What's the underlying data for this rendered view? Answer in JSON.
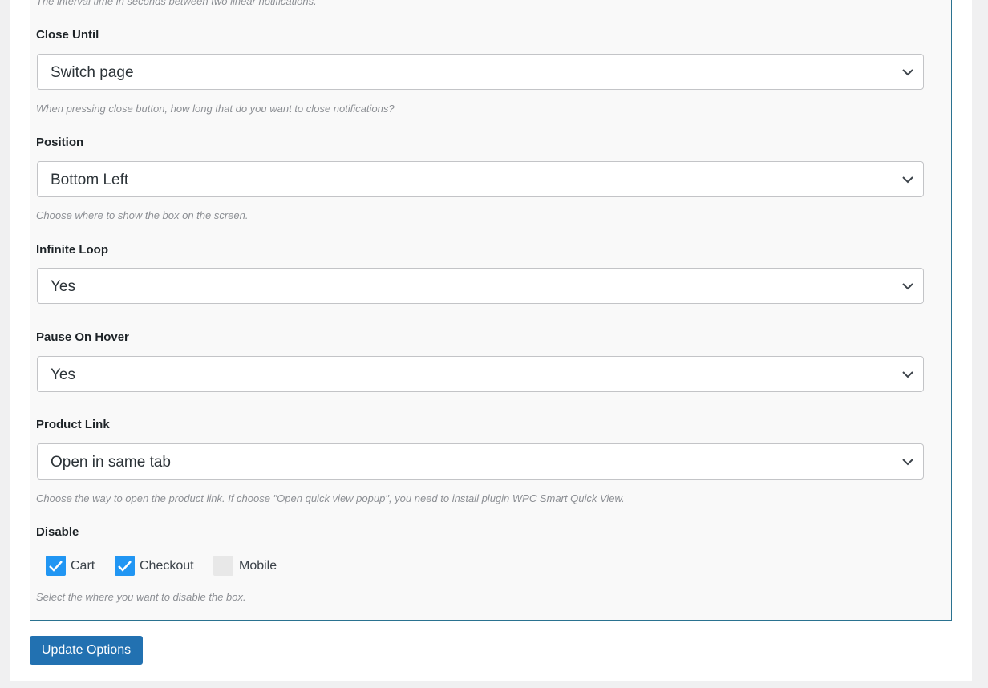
{
  "top_description": "The interval time in seconds between two linear notifications.",
  "fields": [
    {
      "label": "Close Until",
      "value": "Switch page",
      "description": "When pressing close button, how long that do you want to close notifications?"
    },
    {
      "label": "Position",
      "value": "Bottom Left",
      "description": "Choose where to show the box on the screen."
    },
    {
      "label": "Infinite Loop",
      "value": "Yes",
      "description": ""
    },
    {
      "label": "Pause On Hover",
      "value": "Yes",
      "description": ""
    },
    {
      "label": "Product Link",
      "value": "Open in same tab",
      "description": "Choose the way to open the product link. If choose \"Open quick view popup\", you need to install plugin WPC Smart Quick View."
    }
  ],
  "disable": {
    "label": "Disable",
    "options": [
      {
        "label": "Cart",
        "checked": true
      },
      {
        "label": "Checkout",
        "checked": true
      },
      {
        "label": "Mobile",
        "checked": false
      }
    ],
    "description": "Select the where you want to disable the box."
  },
  "update_button": "Update Options",
  "colors": {
    "accent": "#2271b1",
    "checkbox": "#2196f3",
    "panel_border": "#2a7290"
  },
  "icons": {
    "select_arrow": "chevron-down-icon",
    "checkbox_mark": "checkmark-icon"
  }
}
